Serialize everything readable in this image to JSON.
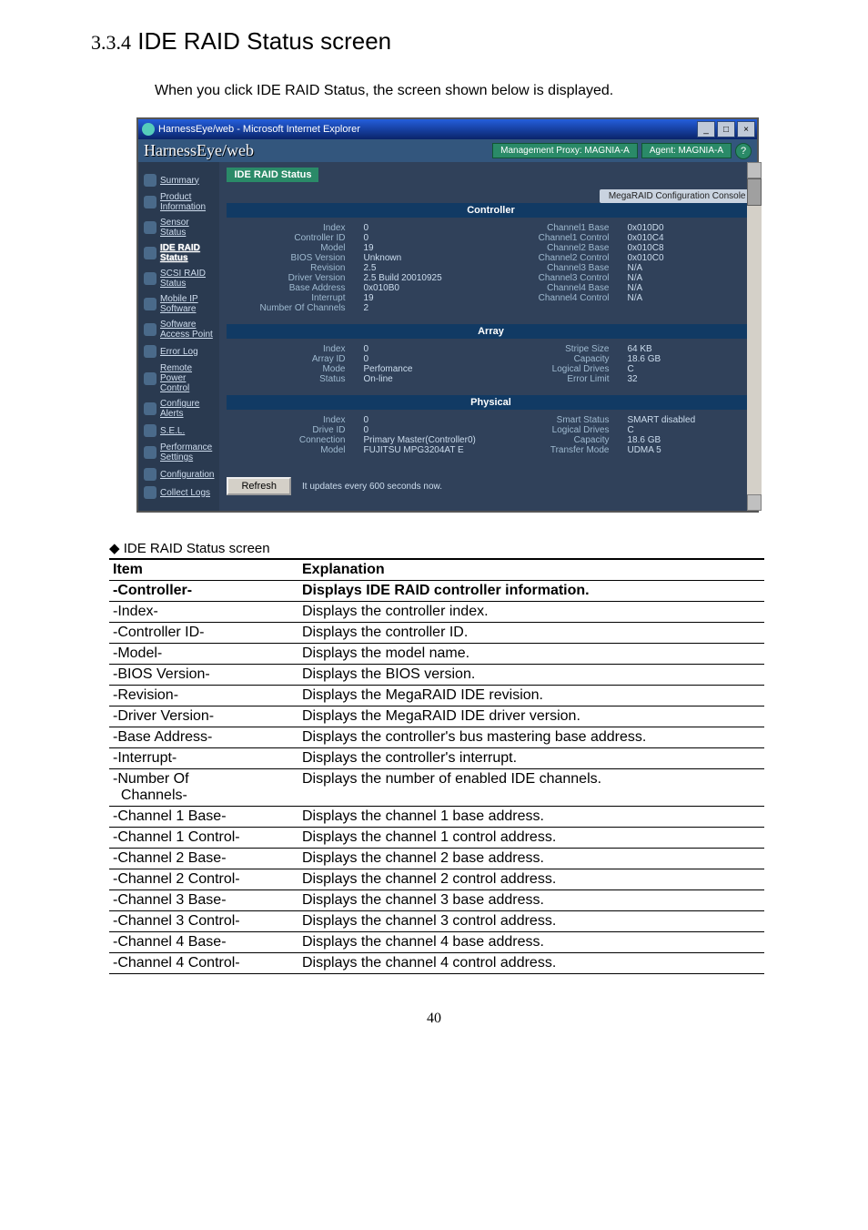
{
  "heading": {
    "number": "3.3.4",
    "title": "IDE RAID Status screen"
  },
  "intro": "When you click IDE RAID Status, the screen shown below is displayed.",
  "browser": {
    "title": "HarnessEye/web - Microsoft Internet Explorer",
    "logo": "HarnessEye/web",
    "proxy_badge": "Management Proxy: MAGNIA-A",
    "agent_badge": "Agent: MAGNIA-A",
    "help": "?"
  },
  "sidebar": [
    "Summary",
    "Product Information",
    "Sensor Status",
    "IDE RAID Status",
    "SCSI RAID Status",
    "Mobile IP Software",
    "Software Access Point",
    "Error Log",
    "Remote Power Control",
    "Configure Alerts",
    "S.E.L.",
    "Performance Settings",
    "Configuration",
    "Collect Logs"
  ],
  "main_panel_title": "IDE RAID Status",
  "config_console": "MegaRAID Configuration Console",
  "section_controller": "Controller",
  "section_array": "Array",
  "section_physical": "Physical",
  "controller_left_labels": [
    "Index",
    "Controller ID",
    "Model",
    "BIOS Version",
    "Revision",
    "Driver Version",
    "Base Address",
    "Interrupt",
    "Number Of Channels"
  ],
  "controller_left_values": [
    "0",
    "0",
    "19",
    "Unknown",
    "2.5",
    "2.5 Build 20010925",
    "0x010B0",
    "19",
    "2"
  ],
  "controller_right_labels": [
    "Channel1 Base",
    "Channel1 Control",
    "Channel2 Base",
    "Channel2 Control",
    "Channel3 Base",
    "Channel3 Control",
    "Channel4 Base",
    "Channel4 Control"
  ],
  "controller_right_values": [
    "0x010D0",
    "0x010C4",
    "0x010C8",
    "0x010C0",
    "N/A",
    "N/A",
    "N/A",
    "N/A"
  ],
  "array_left_labels": [
    "Index",
    "Array ID",
    "Mode",
    "Status"
  ],
  "array_left_values": [
    "0",
    "0",
    "Perfomance",
    "On-line"
  ],
  "array_right_labels": [
    "Stripe Size",
    "Capacity",
    "Logical Drives",
    "Error Limit"
  ],
  "array_right_values": [
    "64 KB",
    "18.6 GB",
    "C",
    "32"
  ],
  "physical_left_labels": [
    "Index",
    "Drive ID",
    "Connection",
    "Model"
  ],
  "physical_left_values": [
    "0",
    "0",
    "Primary Master(Controller0)",
    "FUJITSU MPG3204AT E"
  ],
  "physical_right_labels": [
    "Smart Status",
    "Logical Drives",
    "Capacity",
    "Transfer Mode"
  ],
  "physical_right_values": [
    "SMART disabled",
    "C",
    "18.6 GB",
    "UDMA 5"
  ],
  "refresh_btn": "Refresh",
  "refresh_note": "It updates every 600 seconds now.",
  "table_caption": "◆ IDE RAID Status screen",
  "table_header": [
    "Item",
    "Explanation"
  ],
  "table_section": [
    "-Controller-",
    "Displays IDE RAID controller information."
  ],
  "table_rows": [
    [
      "-Index-",
      "Displays the controller index."
    ],
    [
      "-Controller ID-",
      "Displays the controller ID."
    ],
    [
      "-Model-",
      "Displays the model name."
    ],
    [
      "-BIOS Version-",
      "Displays the BIOS version."
    ],
    [
      "-Revision-",
      "Displays the MegaRAID IDE revision."
    ],
    [
      "-Driver Version-",
      "Displays the MegaRAID IDE driver version."
    ],
    [
      "-Base Address-",
      "Displays the controller's bus mastering base address."
    ],
    [
      "-Interrupt-",
      "Displays the controller's interrupt."
    ],
    [
      "-Number Of\n  Channels-",
      "Displays the number of enabled IDE channels."
    ],
    [
      "-Channel 1 Base-",
      "Displays the channel 1 base address."
    ],
    [
      "-Channel 1 Control-",
      "Displays the channel 1 control address."
    ],
    [
      "-Channel 2 Base-",
      "Displays the channel 2 base address."
    ],
    [
      "-Channel 2 Control-",
      "Displays the channel 2 control address."
    ],
    [
      "-Channel 3 Base-",
      "Displays the channel 3 base address."
    ],
    [
      "-Channel 3 Control-",
      "Displays the channel 3 control address."
    ],
    [
      "-Channel 4 Base-",
      "Displays the channel 4 base address."
    ],
    [
      "-Channel 4 Control-",
      "Displays the channel 4 control address."
    ]
  ],
  "page_number": "40"
}
